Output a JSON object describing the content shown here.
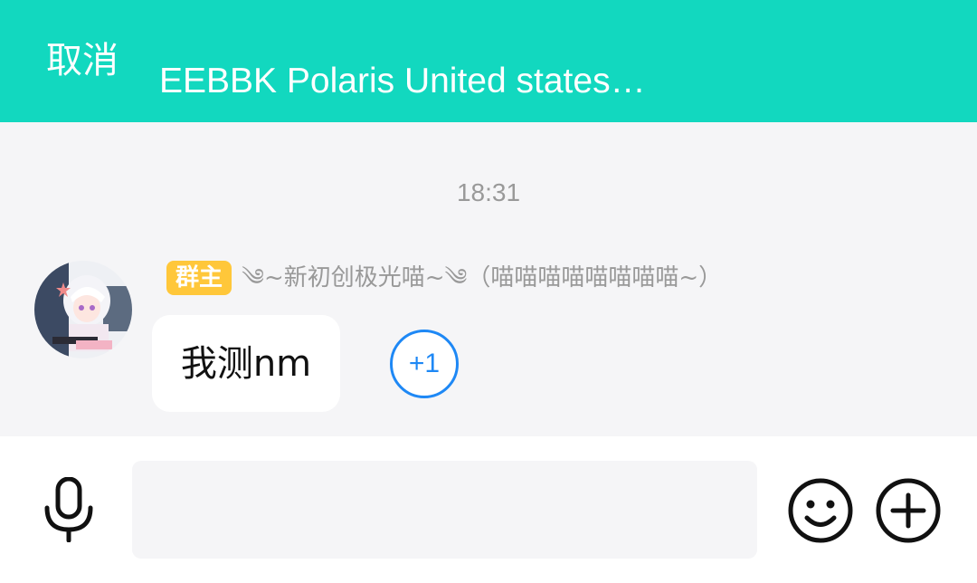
{
  "header": {
    "cancel_label": "取消",
    "title": "EEBBK Polaris United states…"
  },
  "chat": {
    "timestamp": "18:31",
    "message": {
      "badge": "群主",
      "sender": "༄~新初创极光喵~༄（喵喵喵喵喵喵喵喵~）",
      "text": "我测nm",
      "reaction": "+1"
    }
  },
  "inputbar": {
    "placeholder": "",
    "value": ""
  },
  "icons": {
    "mic": "microphone-icon",
    "emoji": "smiley-face-icon",
    "plus": "plus-circle-icon"
  },
  "colors": {
    "header": "#12d8bf",
    "badge": "#ffc73a",
    "reaction": "#1e88f5"
  }
}
